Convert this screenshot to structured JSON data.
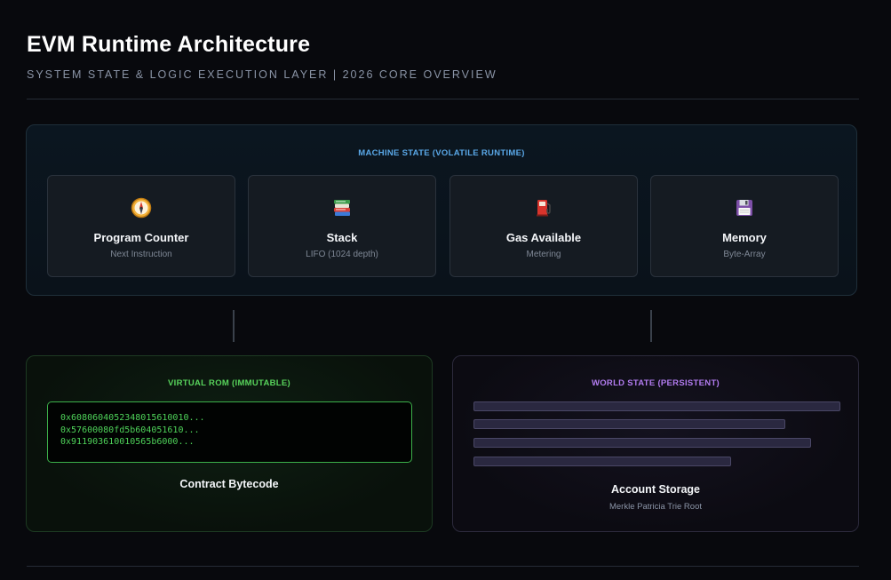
{
  "header": {
    "title": "EVM Runtime Architecture",
    "subtitle": "SYSTEM STATE & LOGIC EXECUTION LAYER | 2026 CORE OVERVIEW"
  },
  "machine_state": {
    "title": "MACHINE STATE (VOLATILE RUNTIME)",
    "cards": [
      {
        "icon": "compass-icon",
        "name": "Program Counter",
        "sub": "Next Instruction"
      },
      {
        "icon": "stack-of-books-icon",
        "name": "Stack",
        "sub": "LIFO (1024 depth)"
      },
      {
        "icon": "fuel-pump-icon",
        "name": "Gas Available",
        "sub": "Metering"
      },
      {
        "icon": "floppy-disk-icon",
        "name": "Memory",
        "sub": "Byte-Array"
      }
    ]
  },
  "virtual_rom": {
    "title": "VIRTUAL ROM (IMMUTABLE)",
    "code_lines": [
      "0x6080604052348015610010...",
      "0x57600080fd5b604051610...",
      "0x911903610010565b6000..."
    ],
    "label": "Contract Bytecode"
  },
  "world_state": {
    "title": "WORLD STATE (PERSISTENT)",
    "label": "Account Storage",
    "sub": "Merkle Patricia Trie Root"
  },
  "colors": {
    "background": "#08090d",
    "machine_accent": "#5aa8e8",
    "rom_accent": "#58d45c",
    "world_accent": "#b27cf0"
  }
}
